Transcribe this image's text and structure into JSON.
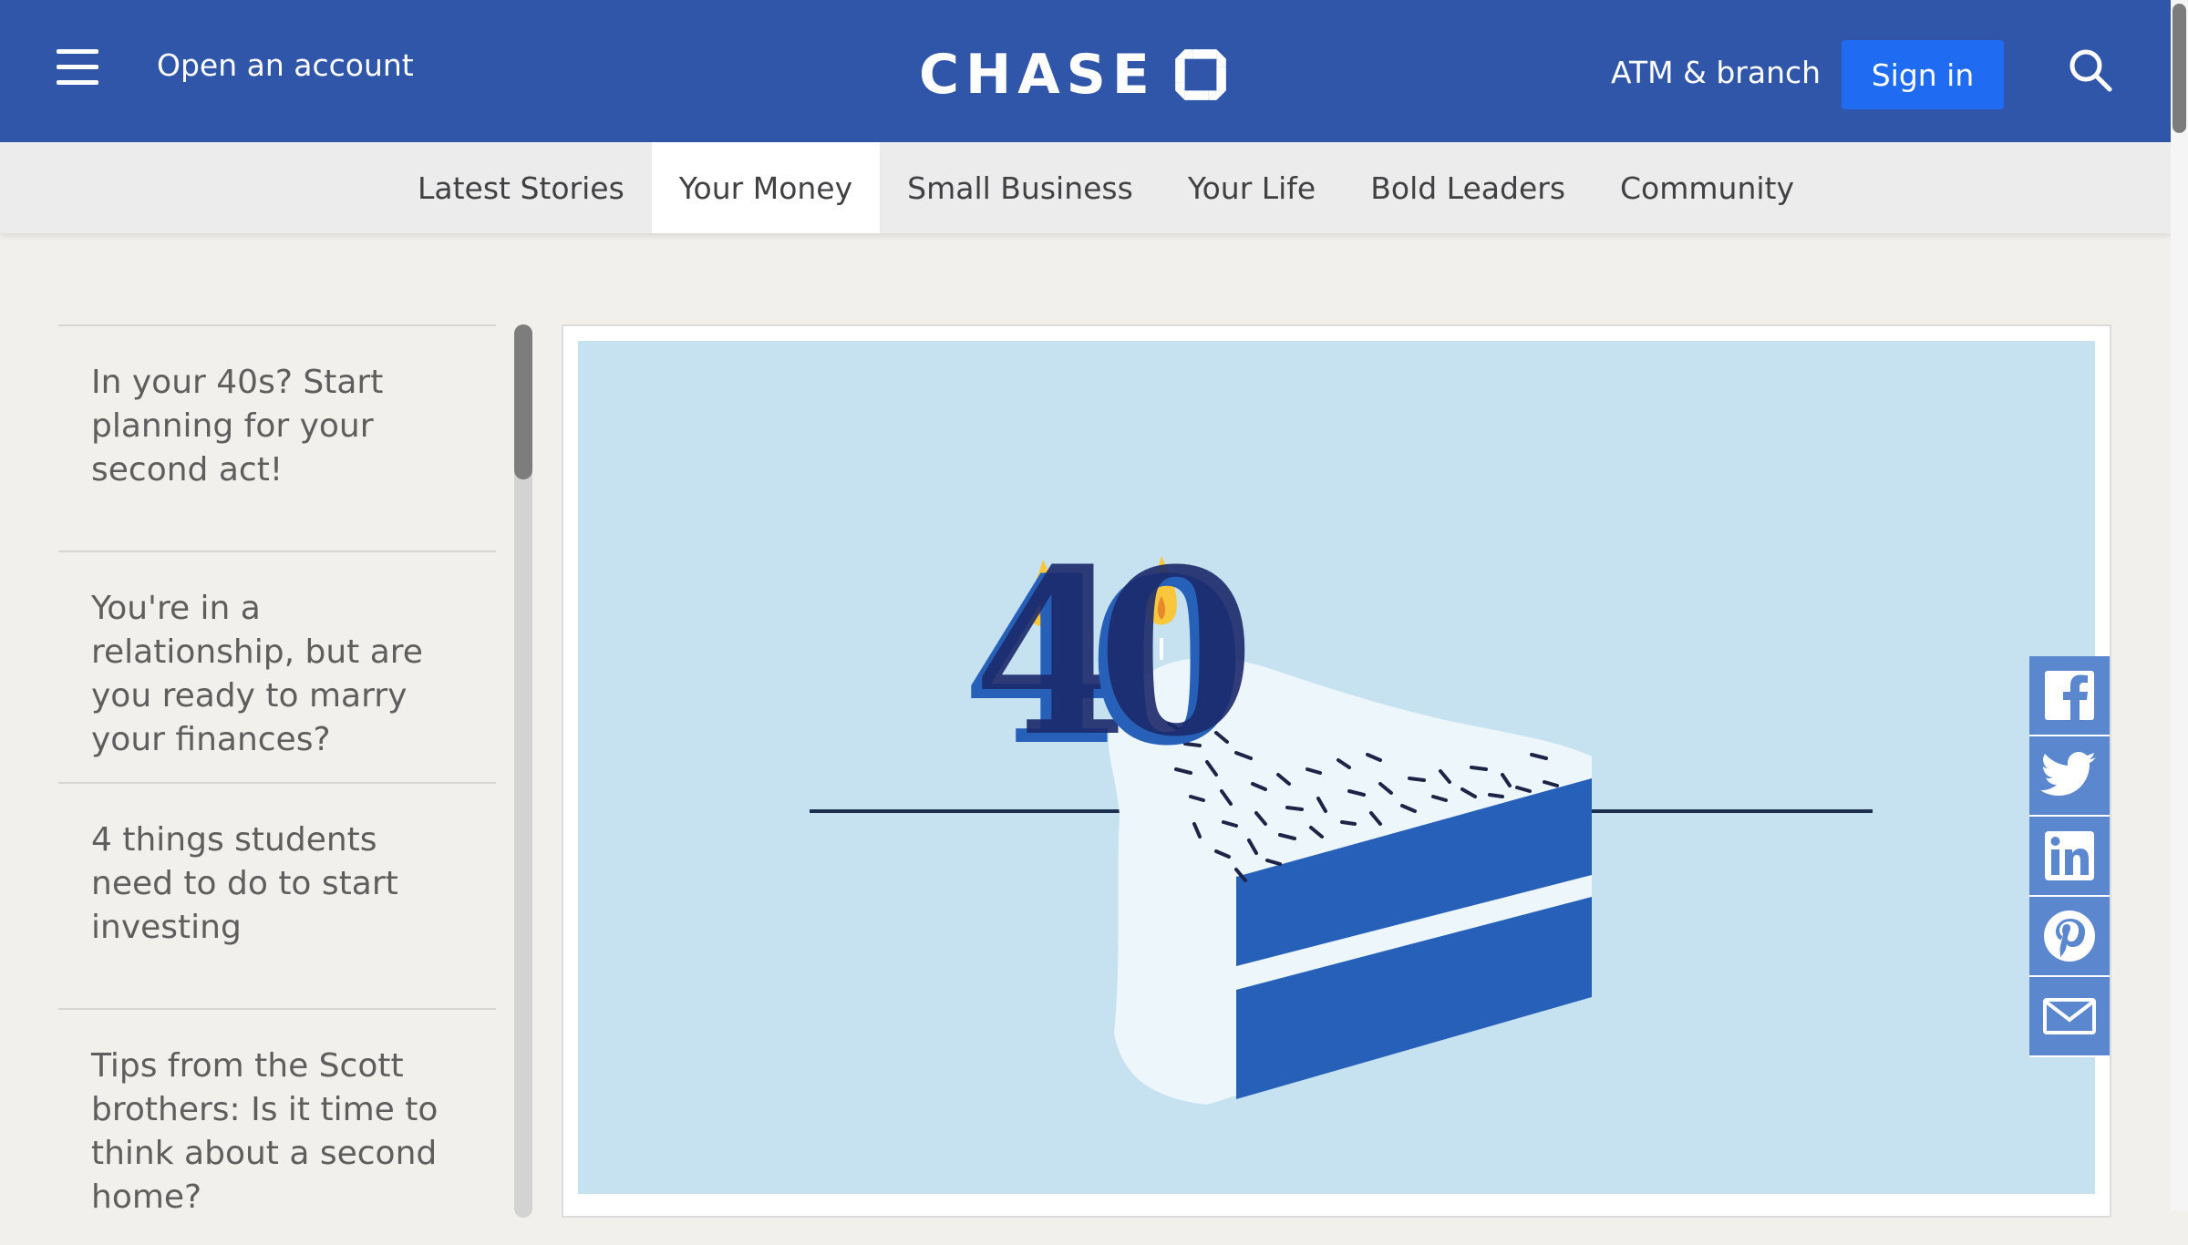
{
  "header": {
    "menu_icon": "hamburger-menu-icon",
    "open_account": "Open an account",
    "logo_text": "CHASE",
    "logo_icon": "chase-octagon-logo-icon",
    "atm_branch": "ATM & branch",
    "sign_in": "Sign in",
    "search_icon": "search-icon",
    "background_color": "#3056aa",
    "sign_in_color": "#1f6cf2"
  },
  "subnav": {
    "items": [
      {
        "label": "Latest Stories",
        "active": false
      },
      {
        "label": "Your Money",
        "active": true
      },
      {
        "label": "Small Business",
        "active": false
      },
      {
        "label": "Your Life",
        "active": false
      },
      {
        "label": "Bold Leaders",
        "active": false
      },
      {
        "label": "Community",
        "active": false
      }
    ]
  },
  "related_articles": {
    "items": [
      {
        "title": "In your 40s? Start planning for your second act!"
      },
      {
        "title": "You're in a relationship, but are you ready to marry your finances?"
      },
      {
        "title": "4 things students need to do to start investing"
      },
      {
        "title": "Tips from the Scott brothers: Is it time to think about a second home?"
      }
    ]
  },
  "hero": {
    "illustration": "birthday-cake-slice-40-candles-illustration",
    "candle_text": "40",
    "background_color": "#c6e2f1"
  },
  "share": {
    "icons": [
      "facebook-icon",
      "twitter-icon",
      "linkedin-icon",
      "pinterest-icon",
      "email-icon"
    ],
    "color": "#5b87cf"
  }
}
